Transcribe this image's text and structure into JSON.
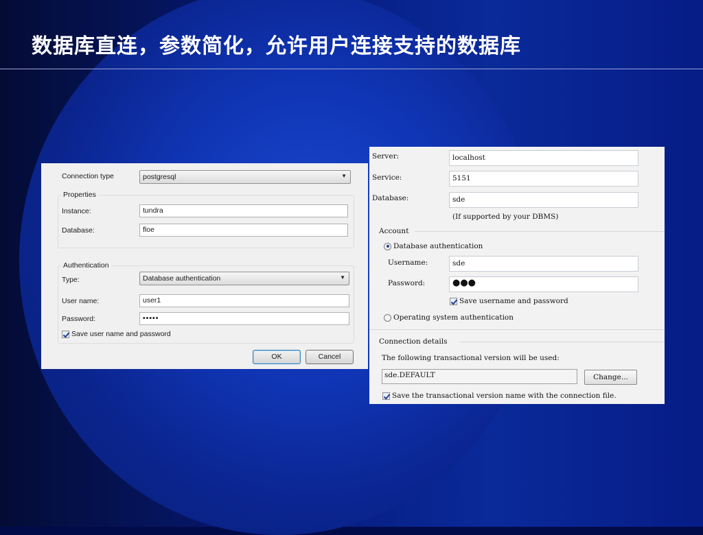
{
  "slide": {
    "title": "数据库直连，参数简化，允许用户连接支持的数据库"
  },
  "left_dialog": {
    "connection_type_label": "Connection type",
    "connection_type_value": "postgresql",
    "properties_group": "Properties",
    "instance_label": "Instance:",
    "instance_value": "tundra",
    "database_label": "Database:",
    "database_value": "floe",
    "authentication_group": "Authentication",
    "type_label": "Type:",
    "type_value": "Database authentication",
    "username_label": "User name:",
    "username_value": "user1",
    "password_label": "Password:",
    "password_value": "•••••",
    "save_checkbox_label": "Save user name and password",
    "save_checked": true,
    "ok_label": "OK",
    "cancel_label": "Cancel"
  },
  "right_dialog": {
    "server_label": "Server:",
    "server_value": "localhost",
    "service_label": "Service:",
    "service_value": "5151",
    "database_label": "Database:",
    "database_value": "sde",
    "database_hint": "(If supported by your DBMS)",
    "account_group": "Account",
    "db_auth_label": "Database authentication",
    "db_auth_selected": true,
    "username_label": "Username:",
    "username_value": "sde",
    "password_label": "Password:",
    "password_value": "●●●",
    "save_label": "Save username and password",
    "save_checked": true,
    "os_auth_label": "Operating system authentication",
    "os_auth_selected": false,
    "connection_group": "Connection details",
    "version_text": "The following transactional version will be used:",
    "version_value": "sde.DEFAULT",
    "change_label": "Change...",
    "save_version_label": "Save the transactional version name with the connection file.",
    "save_version_checked": true
  },
  "colors": {
    "background": "#061a7a",
    "title_text": "#ffffff",
    "dialog_bg": "#f0f0f0"
  }
}
